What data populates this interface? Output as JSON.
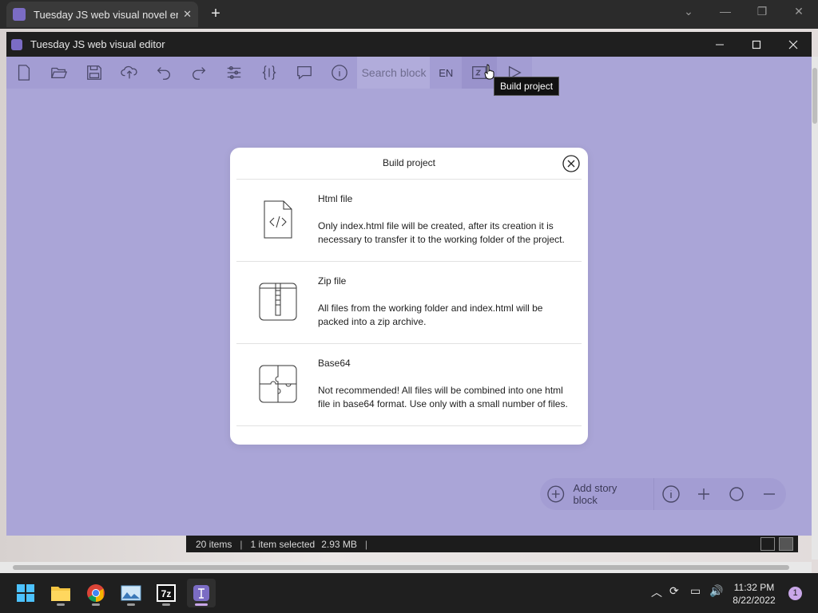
{
  "browser": {
    "tab_title": "Tuesday JS web visual novel engi",
    "new_tab": "+"
  },
  "app": {
    "title": "Tuesday JS web visual editor",
    "toolbar": {
      "search_placeholder": "Search block",
      "language": "EN",
      "icons": [
        "new-file-icon",
        "open-folder-icon",
        "save-icon",
        "cloud-sync-icon",
        "undo-icon",
        "redo-icon",
        "settings-sliders-icon",
        "braces-icon",
        "comment-icon",
        "info-icon",
        "build-icon",
        "play-icon"
      ]
    },
    "tooltip": "Build project",
    "modal": {
      "title": "Build project",
      "options": [
        {
          "name": "Html file",
          "description": "Only index.html file will be created, after its creation it is necessary to transfer it to the working folder of the project.",
          "icon": "html-file-icon"
        },
        {
          "name": "Zip file",
          "description": "All files from the working folder and index.html will be packed into a zip archive.",
          "icon": "zip-archive-icon"
        },
        {
          "name": "Base64",
          "description": "Not recommended! All files will be combined into one html file in base64 format. Use only with a small number of files.",
          "icon": "puzzle-icon"
        }
      ]
    },
    "story_controls": {
      "add_label": "Add story block"
    }
  },
  "statusbar": {
    "items_count": "20 items",
    "selection": "1 item selected",
    "size": "2.93 MB"
  },
  "taskbar": {
    "apps": [
      "windows-start-icon",
      "file-explorer-icon",
      "chrome-icon",
      "photos-icon",
      "7zip-icon",
      "tuesday-editor-icon"
    ],
    "time": "11:32 PM",
    "date": "8/22/2022",
    "notifications": "1"
  },
  "colors": {
    "workspace": "#aaa5d7",
    "toolbar": "#a39dd3",
    "accent": "#7b6cc4"
  }
}
